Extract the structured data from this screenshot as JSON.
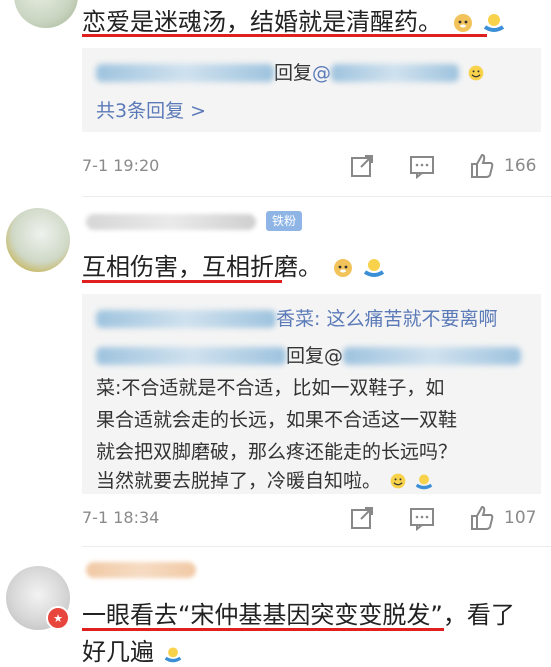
{
  "comments": [
    {
      "text": "恋爱是迷魂汤，结婚就是清醒药。",
      "reply": {
        "reply_word": "回复",
        "at": "@"
      },
      "more_replies": "共3条回复 >",
      "time": "7-1 19:20",
      "likes": "166"
    },
    {
      "tag": "铁粉",
      "text": "互相伤害，互相折磨。",
      "reply1_tail": "香菜: 这么痛苦就不要离啊",
      "reply2_mid": "回复@",
      "reply2_lines": [
        "菜:不合适就是不合适，比如一双鞋子，如",
        "果合适就会走的长远，如果不合适这一双鞋",
        "就会把双脚磨破，那么疼还能走的长远吗？",
        "当然就要去脱掉了，冷暖自知啦。"
      ],
      "time": "7-1 18:34",
      "likes": "107"
    },
    {
      "text_line1": "一眼看去“宋仲基基因突变变脱发”，看了",
      "text_line2": "好几遍"
    }
  ]
}
